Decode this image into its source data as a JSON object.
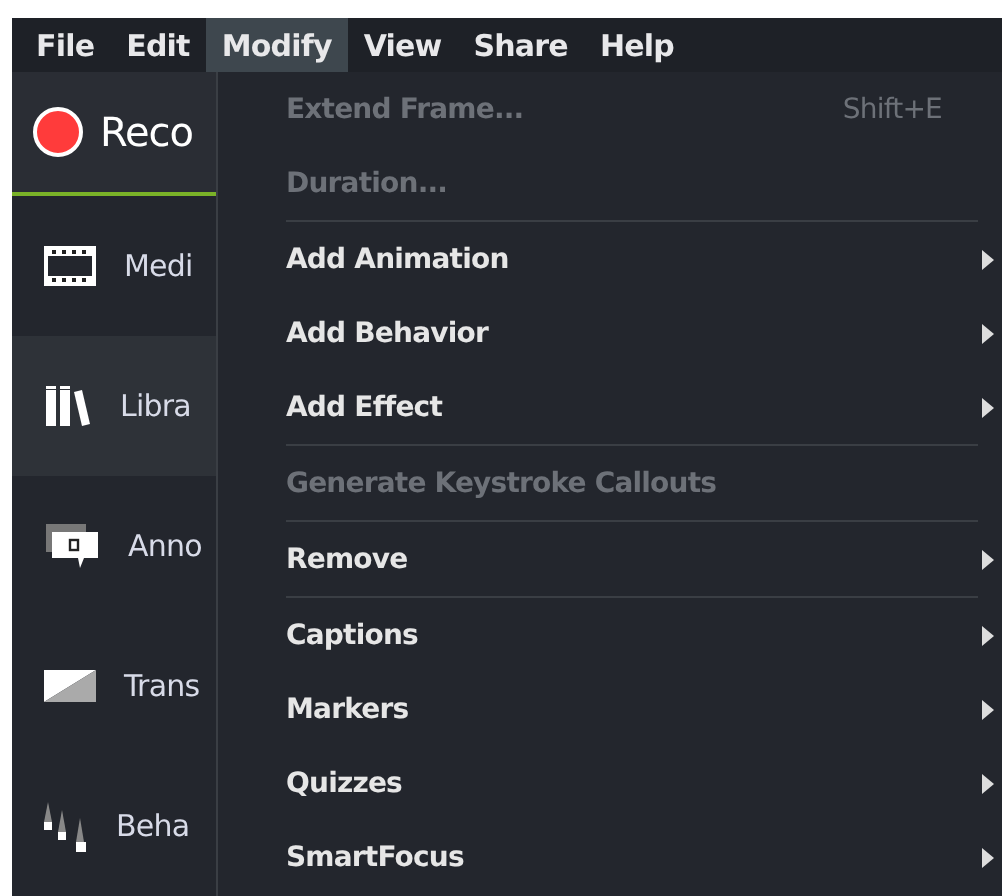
{
  "menubar": [
    {
      "label": "File",
      "selected": false
    },
    {
      "label": "Edit",
      "selected": false
    },
    {
      "label": "Modify",
      "selected": true
    },
    {
      "label": "View",
      "selected": false
    },
    {
      "label": "Share",
      "selected": false
    },
    {
      "label": "Help",
      "selected": false
    }
  ],
  "record_button": {
    "label": "Reco"
  },
  "sidebar": {
    "items": [
      {
        "label": "Medi",
        "kind": "media",
        "selected": false
      },
      {
        "label": "Libra",
        "kind": "library",
        "selected": true
      },
      {
        "label": "Anno",
        "kind": "annotations",
        "selected": false
      },
      {
        "label": "Trans",
        "kind": "transitions",
        "selected": false
      },
      {
        "label": "Beha",
        "kind": "behaviors",
        "selected": false
      }
    ]
  },
  "menu": {
    "items": [
      {
        "label": "Extend Frame...",
        "shortcut": "Shift+E",
        "disabled": true,
        "submenu": false,
        "separator_after": false
      },
      {
        "label": "Duration...",
        "disabled": true,
        "submenu": false,
        "separator_after": true
      },
      {
        "label": "Add Animation",
        "disabled": false,
        "submenu": true,
        "separator_after": false
      },
      {
        "label": "Add Behavior",
        "disabled": false,
        "submenu": true,
        "separator_after": false
      },
      {
        "label": "Add Effect",
        "disabled": false,
        "submenu": true,
        "separator_after": true
      },
      {
        "label": "Generate Keystroke Callouts",
        "disabled": true,
        "submenu": false,
        "separator_after": true
      },
      {
        "label": "Remove",
        "disabled": false,
        "submenu": true,
        "separator_after": true
      },
      {
        "label": "Captions",
        "disabled": false,
        "submenu": true,
        "separator_after": false
      },
      {
        "label": "Markers",
        "disabled": false,
        "submenu": true,
        "separator_after": false
      },
      {
        "label": "Quizzes",
        "disabled": false,
        "submenu": true,
        "separator_after": false
      },
      {
        "label": "SmartFocus",
        "disabled": false,
        "submenu": true,
        "separator_after": false
      }
    ]
  }
}
